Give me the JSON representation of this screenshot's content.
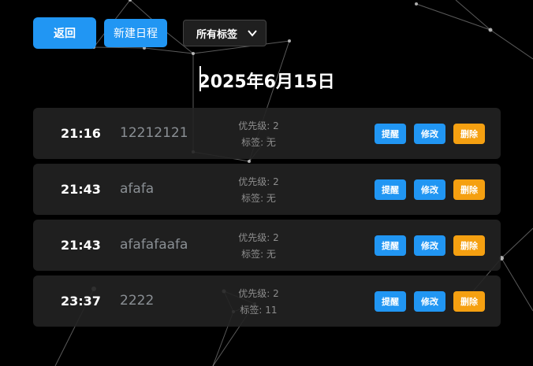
{
  "toolbar": {
    "back_label": "返回",
    "new_label": "新建日程",
    "tag_filter": {
      "selected": "所有标签"
    }
  },
  "header": {
    "date": "2025年6月15日"
  },
  "schedule": {
    "items": [
      {
        "time": "21:16",
        "title": "12212121",
        "priority": "优先级: 2",
        "tags": "标签: 无"
      },
      {
        "time": "21:43",
        "title": "afafa",
        "priority": "优先级: 2",
        "tags": "标签: 无"
      },
      {
        "time": "21:43",
        "title": "afafafaafa",
        "priority": "优先级: 2",
        "tags": "标签: 无"
      },
      {
        "time": "23:37",
        "title": "2222",
        "priority": "优先级: 2",
        "tags": "标签: 11"
      }
    ],
    "actions": {
      "remind": "提醒",
      "edit": "修改",
      "delete": "删除"
    }
  },
  "colors": {
    "primary": "#2196f3",
    "warning": "#f5a011",
    "background": "#000000",
    "row": "#222222"
  }
}
